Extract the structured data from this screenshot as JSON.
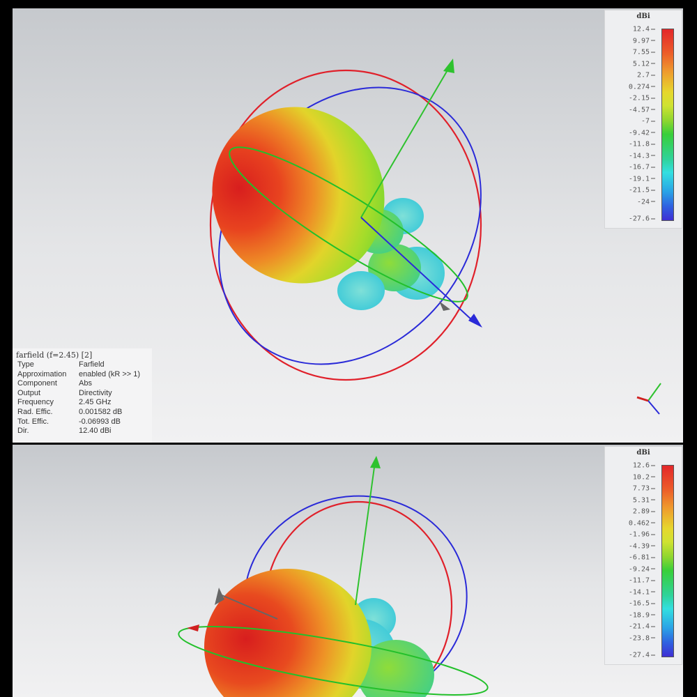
{
  "top_view": {
    "colorbar": {
      "unit": "dBi",
      "ticks": [
        "12.4",
        "9.97",
        "7.55",
        "5.12",
        "2.7",
        "0.274",
        "-2.15",
        "-4.57",
        "-7",
        "-9.42",
        "-11.8",
        "-14.3",
        "-16.7",
        "-19.1",
        "-21.5",
        "-24",
        "-27.6"
      ]
    },
    "info": {
      "title": "farfield (f=2.45) [2]",
      "rows": [
        {
          "key": "Type",
          "value": "Farfield"
        },
        {
          "key": "Approximation",
          "value": "enabled (kR >> 1)"
        },
        {
          "key": "Component",
          "value": "Abs"
        },
        {
          "key": "Output",
          "value": "Directivity"
        },
        {
          "key": "Frequency",
          "value": "2.45 GHz"
        },
        {
          "key": "Rad. Effic.",
          "value": "0.001582 dB"
        },
        {
          "key": "Tot. Effic.",
          "value": "-0.06993 dB"
        },
        {
          "key": "Dir.",
          "value": "12.40 dBi"
        }
      ]
    }
  },
  "bottom_view": {
    "colorbar": {
      "unit": "dBi",
      "ticks": [
        "12.6",
        "10.2",
        "7.73",
        "5.31",
        "2.89",
        "0.462",
        "-1.96",
        "-4.39",
        "-6.81",
        "-9.24",
        "-11.7",
        "-14.1",
        "-16.5",
        "-18.9",
        "-21.4",
        "-23.8",
        "-27.4"
      ]
    }
  }
}
